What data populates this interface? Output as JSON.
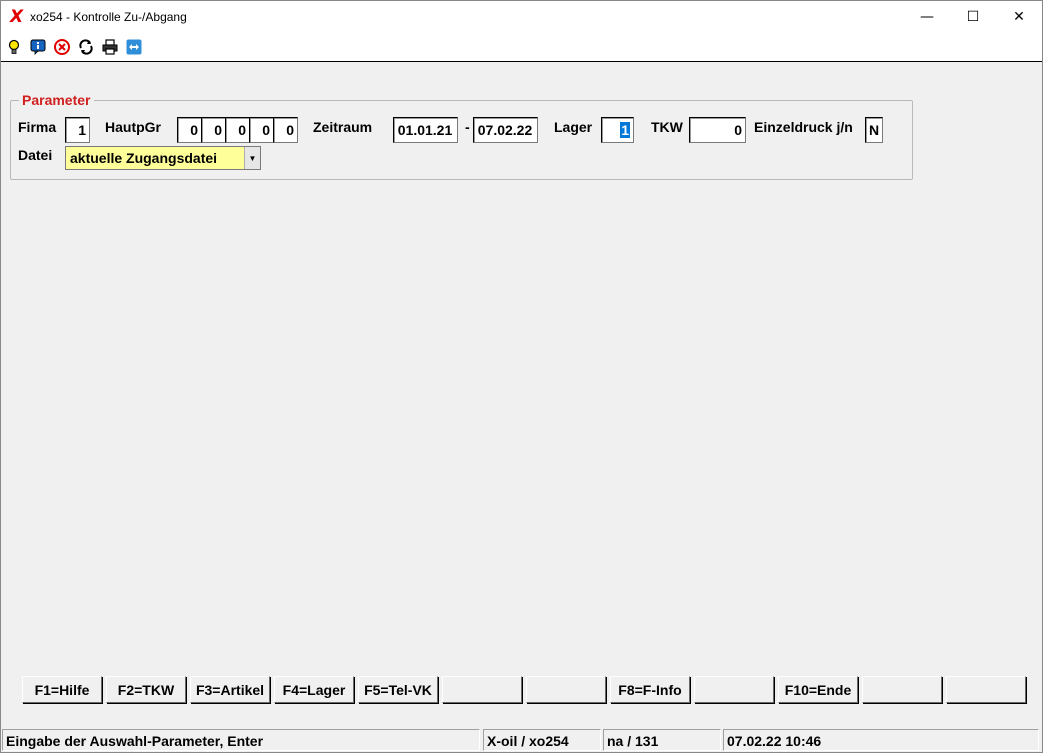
{
  "window": {
    "title": "xo254 - Kontrolle Zu-/Abgang",
    "app_icon": "x-oil-logo",
    "minimize_glyph": "—",
    "maximize_glyph": "☐",
    "close_glyph": "✕"
  },
  "toolbar": {
    "icons": [
      "lightbulb-icon",
      "info-icon",
      "stop-icon",
      "refresh-icon",
      "print-icon",
      "remote-icon"
    ]
  },
  "parameter": {
    "legend": "Parameter",
    "firma_label": "Firma",
    "firma_value": "1",
    "hauptgr_label": "HautpGr",
    "hauptgr_values": [
      "0",
      "0",
      "0",
      "0",
      "0"
    ],
    "zeitraum_label": "Zeitraum",
    "zeitraum_from": "01.01.21",
    "zeitraum_sep": "-",
    "zeitraum_to": "07.02.22",
    "lager_label": "Lager",
    "lager_value": "1",
    "tkw_label": "TKW",
    "tkw_value": "0",
    "einzeldruck_label": "Einzeldruck j/n",
    "einzeldruck_value": "N",
    "datei_label": "Datei",
    "datei_value": "aktuelle Zugangsdatei"
  },
  "function_keys": [
    "F1=Hilfe",
    "F2=TKW",
    "F3=Artikel",
    "F4=Lager",
    "F5=Tel-VK",
    "",
    "",
    "F8=F-Info",
    "",
    "F10=Ende",
    "",
    ""
  ],
  "status": {
    "message": "Eingabe der Auswahl-Parameter, Enter",
    "program": "X-oil / xo254",
    "user": "na / 131",
    "datetime": "07.02.22 10:46"
  },
  "colors": {
    "legend": "#d02020",
    "combo_bg": "#ffff99",
    "selection": "#0078d7"
  }
}
